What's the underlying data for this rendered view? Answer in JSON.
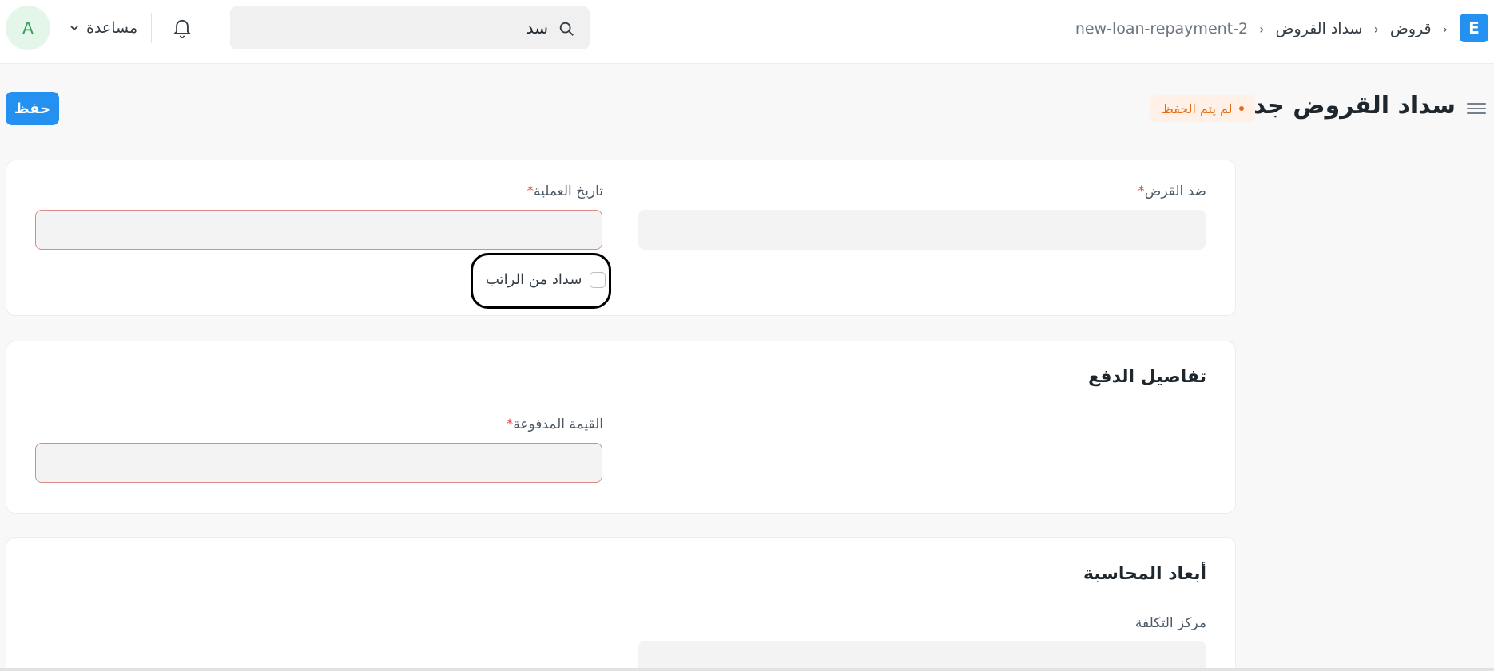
{
  "navbar": {
    "logo_letter": "E",
    "breadcrumbs": [
      "قروض",
      "سداد القروض",
      "new-loan-repayment-2"
    ],
    "crumb_separator": "›",
    "search": {
      "value": "سد"
    },
    "help_label": "مساعدة",
    "avatar_letter": "A"
  },
  "page": {
    "title": "سداد القروض جديد",
    "indicator": "لم يتم الحفظ",
    "save_label": "حفظ"
  },
  "form": {
    "against_loan": {
      "label": "ضد القرض",
      "required_mark": "*"
    },
    "posting_date": {
      "label": "تاريخ العملية",
      "required_mark": "*"
    },
    "repay_from_salary": {
      "label": "سداد من الراتب",
      "checked": false
    },
    "payment_details": {
      "title": "تفاصيل الدفع",
      "amount_paid": {
        "label": "القيمة المدفوعة",
        "required_mark": "*"
      }
    },
    "accounting_dimensions": {
      "title": "أبعاد المحاسبة",
      "cost_center": {
        "label": "مركز التكلفة"
      }
    }
  },
  "colors": {
    "primary": "#2490ef",
    "indicator_bg": "#fff1e7",
    "indicator_text": "#e86c13",
    "required": "#e24c4c",
    "error_border": "#d88a8a"
  }
}
